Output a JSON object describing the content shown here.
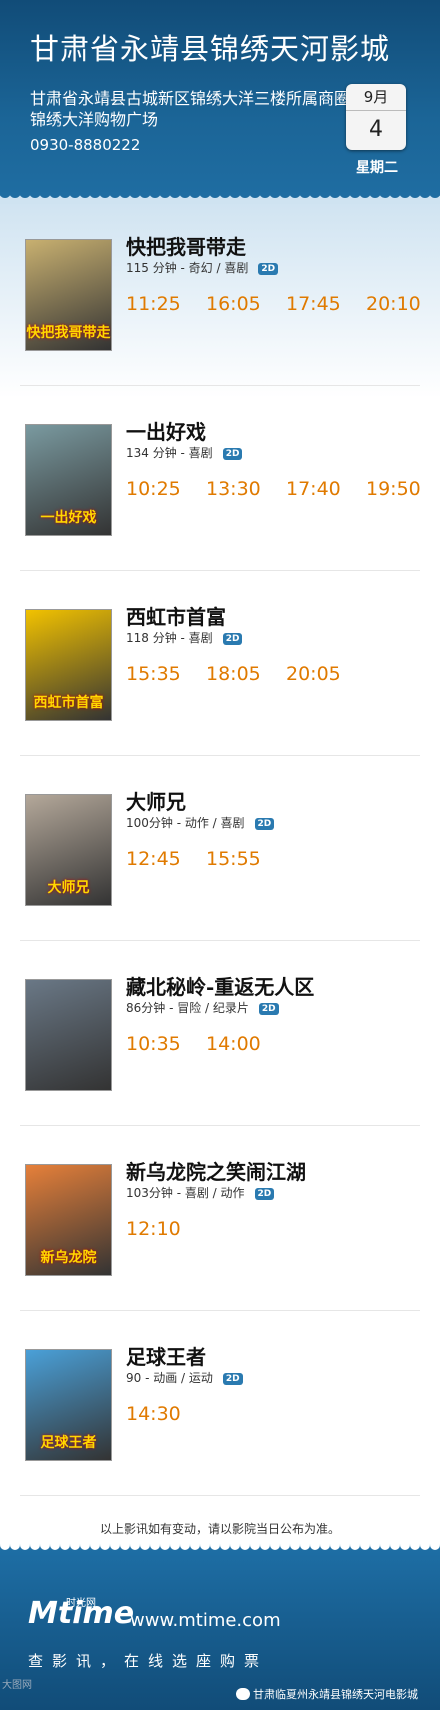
{
  "cinema": {
    "name": "甘肃省永靖县锦绣天河影城",
    "address": "甘肃省永靖县古城新区锦绣大洋三楼所属商圈锦绣大洋购物广场",
    "phone": "0930-8880222"
  },
  "date": {
    "month": "9月",
    "day": "4",
    "weekday": "星期二"
  },
  "movies": [
    {
      "title": "快把我哥带走",
      "meta": "115 分钟 - 奇幻 / 喜剧",
      "format": "2D",
      "times": [
        "11:25",
        "16:05",
        "17:45",
        "20:10"
      ],
      "poster_text": "快把我哥带走",
      "poster_color": "#c8b070"
    },
    {
      "title": "一出好戏",
      "meta": "134 分钟 - 喜剧",
      "format": "2D",
      "times": [
        "10:25",
        "13:30",
        "17:40",
        "19:50"
      ],
      "poster_text": "一出好戏",
      "poster_color": "#7a9aa0"
    },
    {
      "title": "西虹市首富",
      "meta": "118 分钟 - 喜剧",
      "format": "2D",
      "times": [
        "15:35",
        "18:05",
        "20:05"
      ],
      "poster_text": "西虹市首富",
      "poster_color": "#f2c200"
    },
    {
      "title": "大师兄",
      "meta": "100分钟 - 动作 / 喜剧",
      "format": "2D",
      "times": [
        "12:45",
        "15:55"
      ],
      "poster_text": "大师兄",
      "poster_color": "#b4a89a"
    },
    {
      "title": "藏北秘岭-重返无人区",
      "meta": "86分钟 - 冒险 / 纪录片",
      "format": "2D",
      "times": [
        "10:35",
        "14:00"
      ],
      "poster_text": "",
      "poster_color": "#6a7886"
    },
    {
      "title": "新乌龙院之笑闹江湖",
      "meta": "103分钟 - 喜剧 / 动作",
      "format": "2D",
      "times": [
        "12:10"
      ],
      "poster_text": "新乌龙院",
      "poster_color": "#e6803a"
    },
    {
      "title": "足球王者",
      "meta": "90 - 动画 / 运动",
      "format": "2D",
      "times": [
        "14:30"
      ],
      "poster_text": "足球王者",
      "poster_color": "#4aa0d8"
    }
  ],
  "notice": "以上影讯如有变动，请以影院当日公布为准。",
  "footer": {
    "logo": "Mtime",
    "logo_cn": "时光网",
    "url": "www.mtime.com",
    "slogan": "查影讯，在线选座购票",
    "wechat": "甘肃临夏州永靖县锦绣天河电影城"
  },
  "watermark": "大图网"
}
